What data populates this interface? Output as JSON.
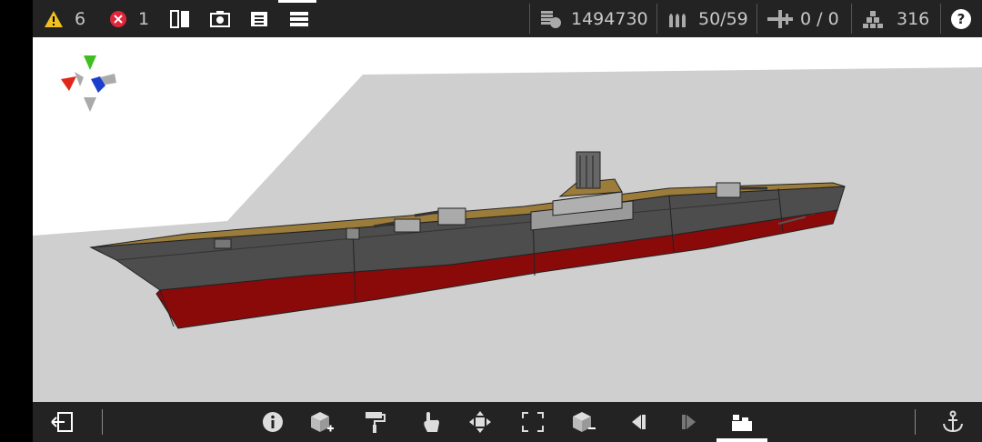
{
  "status": {
    "warnings_count": "6",
    "errors_count": "1"
  },
  "stats": {
    "cost": "1494730",
    "ammo": "50/59",
    "aircraft": "0 / 0",
    "parts": "316"
  },
  "help_label": "?",
  "toolbar": {
    "top_active": "menu",
    "bottom_active": "side-view"
  },
  "colors": {
    "bar_bg": "#232323",
    "hull_red": "#8a0a0a",
    "hull_grey": "#4a4a4a",
    "deck_tan": "#9c7c3a",
    "ground": "#cfcfcf",
    "warning_yellow": "#f0c020",
    "error_red": "#e0263a"
  }
}
